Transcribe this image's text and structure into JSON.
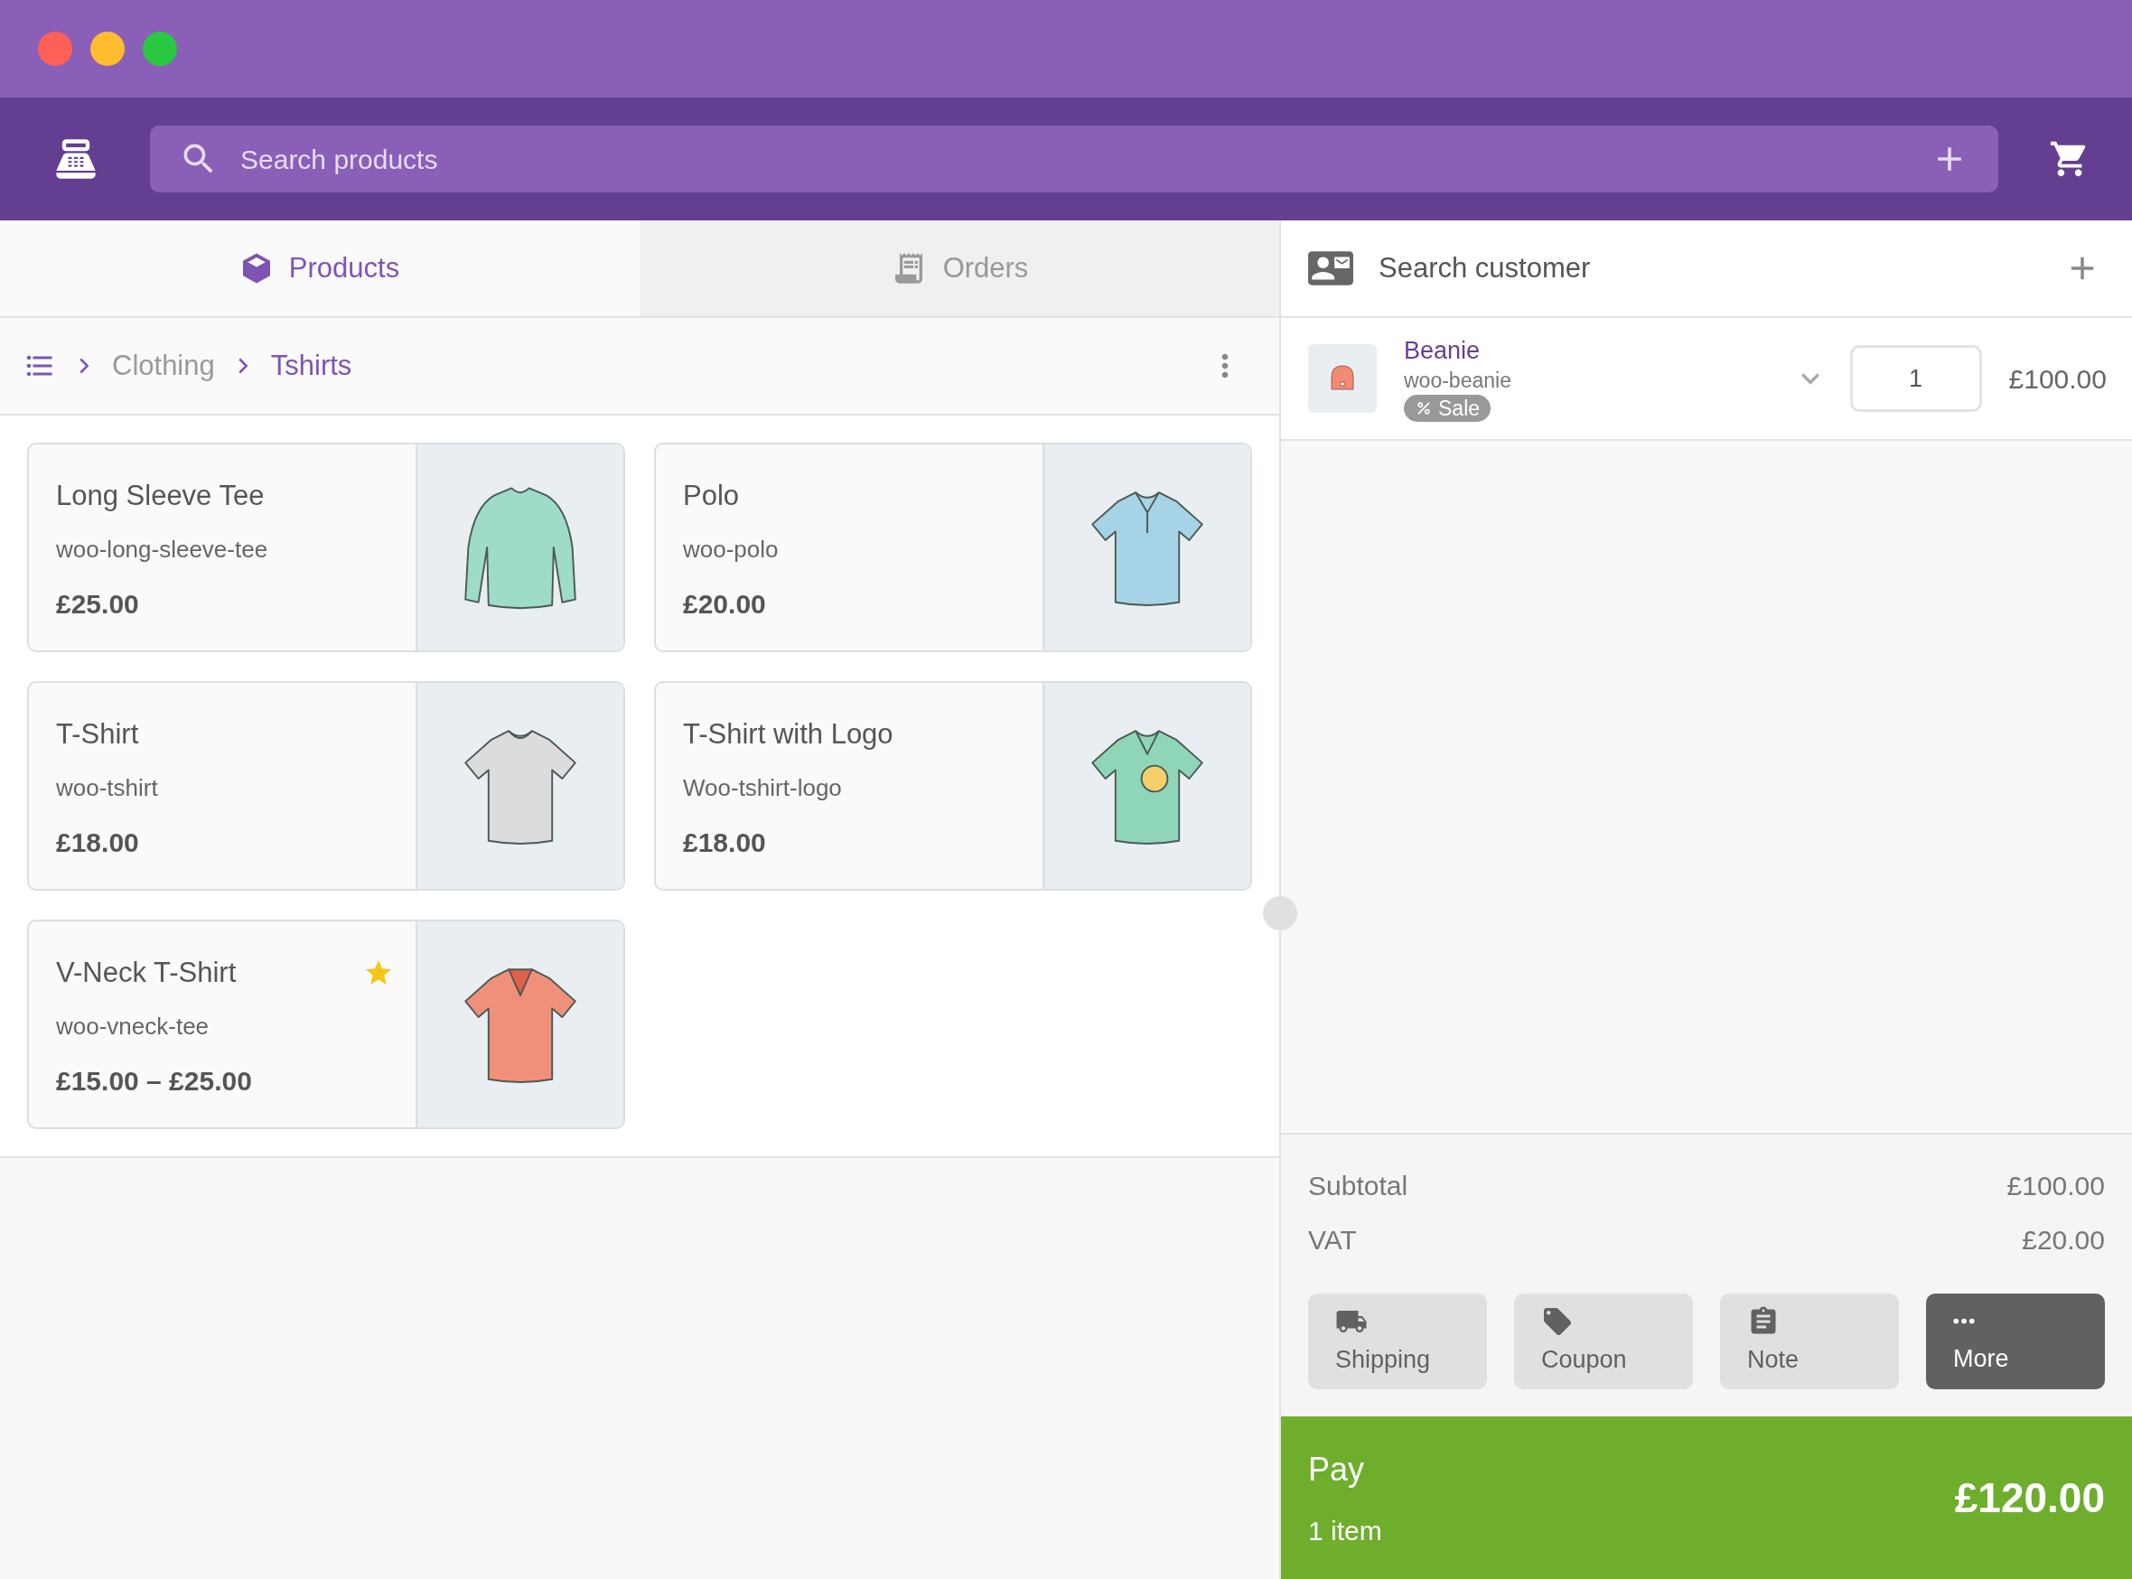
{
  "header": {
    "search": {
      "placeholder": "Search products"
    }
  },
  "tabs": [
    {
      "label": "Products",
      "kind": "products",
      "selected": true
    },
    {
      "label": "Orders",
      "kind": "orders",
      "selected": false
    }
  ],
  "breadcrumb": [
    {
      "label": "Clothing",
      "current": false
    },
    {
      "label": "Tshirts",
      "current": true
    }
  ],
  "products": [
    {
      "name": "Long Sleeve Tee",
      "sku": "woo-long-sleeve-tee",
      "price": "£25.00",
      "featured": false,
      "kind": "long_sleeve",
      "color": "#9fdcc8"
    },
    {
      "name": "Polo",
      "sku": "woo-polo",
      "price": "£20.00",
      "featured": false,
      "kind": "polo",
      "color": "#a6d3e6"
    },
    {
      "name": "T-Shirt",
      "sku": "woo-tshirt",
      "price": "£18.00",
      "featured": false,
      "kind": "tshirt",
      "color": "#dcdcdc"
    },
    {
      "name": "T-Shirt with Logo",
      "sku": "Woo-tshirt-logo",
      "price": "£18.00",
      "featured": false,
      "kind": "logo",
      "color": "#8fd6b8"
    },
    {
      "name": "V-Neck T-Shirt",
      "sku": "woo-vneck-tee",
      "price": "£15.00 – £25.00",
      "featured": true,
      "kind": "vneck",
      "color": "#f0907a"
    }
  ],
  "customer": {
    "placeholder": "Search customer"
  },
  "cart": [
    {
      "name": "Beanie",
      "sku": "woo-beanie",
      "badge": "Sale",
      "quantity": "1",
      "price": "£100.00"
    }
  ],
  "totals": [
    {
      "label": "Subtotal",
      "value": "£100.00"
    },
    {
      "label": "VAT",
      "value": "£20.00"
    }
  ],
  "actions": [
    {
      "label": "Shipping",
      "kind": "shipping"
    },
    {
      "label": "Coupon",
      "kind": "coupon"
    },
    {
      "label": "Note",
      "kind": "note"
    },
    {
      "label": "More",
      "kind": "more"
    }
  ],
  "pay": {
    "label": "Pay",
    "count": "1 item",
    "total": "£120.00"
  }
}
